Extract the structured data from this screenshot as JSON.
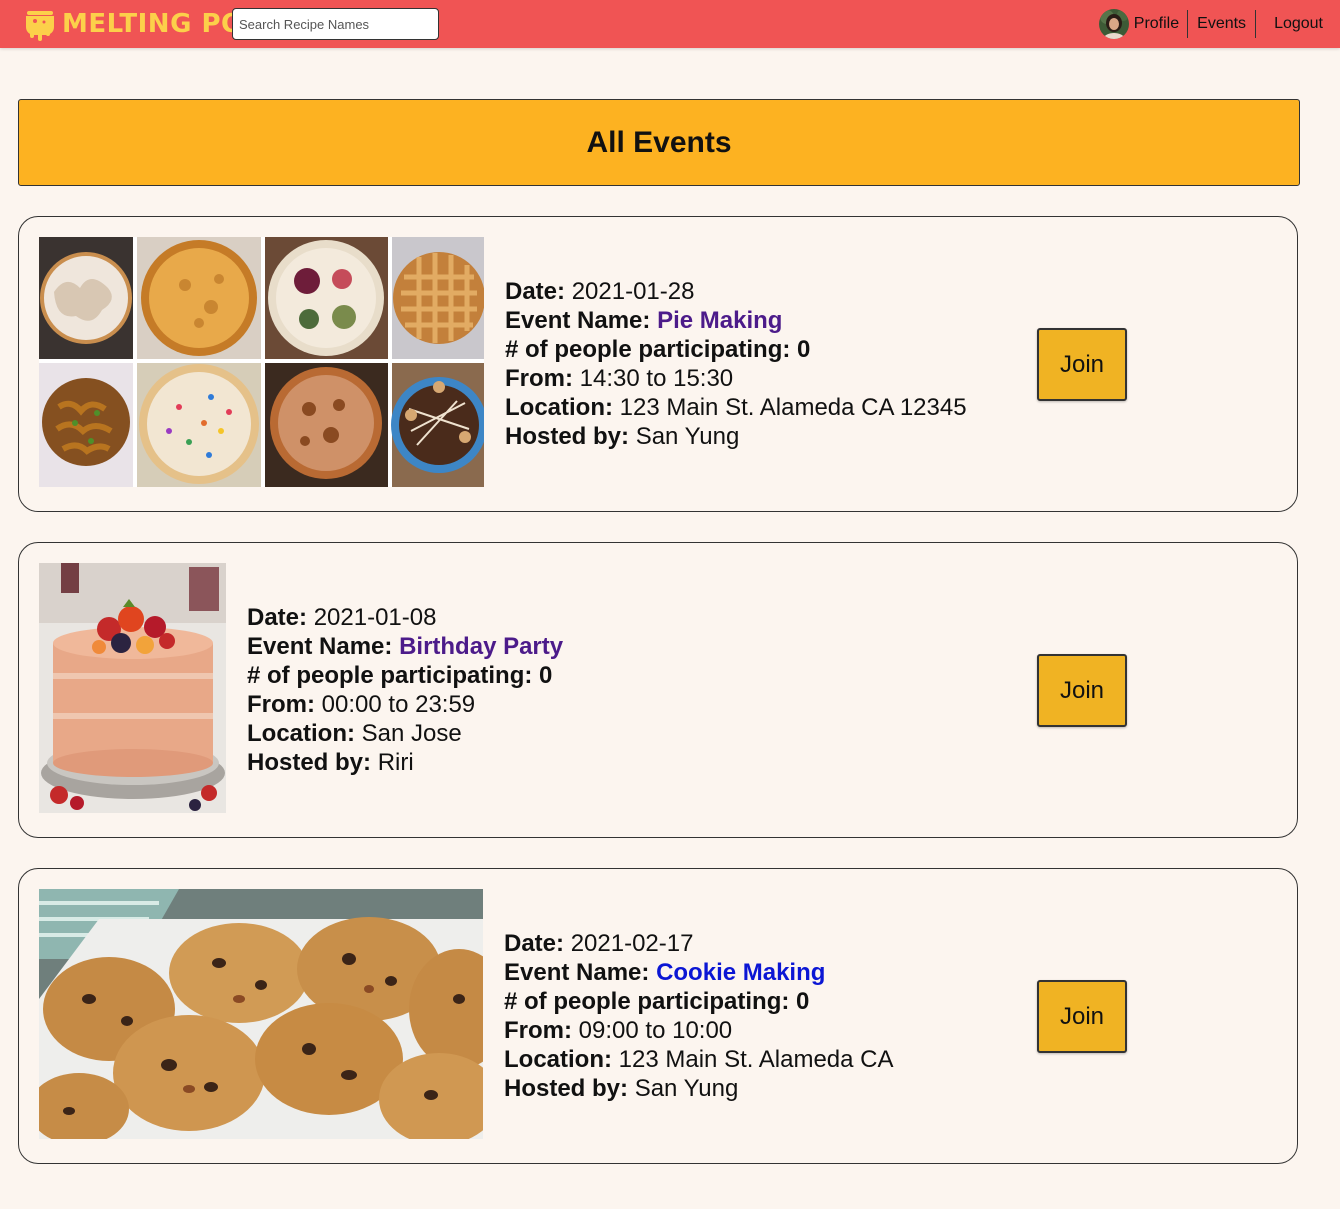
{
  "app": {
    "brand": "MELTING POT",
    "brand_color": "#fcd04a",
    "header_color": "#f05454",
    "background_color": "#fcf5ef"
  },
  "search": {
    "placeholder": "Search Recipe Names",
    "value": ""
  },
  "nav": {
    "profile": "Profile",
    "events": "Events",
    "logout": "Logout"
  },
  "page": {
    "title": "All Events",
    "banner_color": "#fdb221"
  },
  "labels": {
    "date": "Date:",
    "event_name": "Event Name:",
    "participants": "# of people participating:",
    "from": "From:",
    "to": "to",
    "location": "Location:",
    "hosted_by": "Hosted by:"
  },
  "events": [
    {
      "date": "2021-01-28",
      "name": "Pie Making",
      "participants": "0",
      "from": "14:30",
      "to": "15:30",
      "location": "123 Main St. Alameda CA 12345",
      "host": "San Yung",
      "join": "Join",
      "image": "pie-collage"
    },
    {
      "date": "2021-01-08",
      "name": "Birthday Party",
      "participants": "0",
      "from": "00:00",
      "to": "23:59",
      "location": "San Jose",
      "host": "Riri",
      "join": "Join",
      "image": "fruit-cake"
    },
    {
      "date": "2021-02-17",
      "name": "Cookie Making",
      "participants": "0",
      "from": "09:00",
      "to": "10:00",
      "location": "123 Main St. Alameda CA",
      "host": "San Yung",
      "join": "Join",
      "image": "chocolate-chip-cookies"
    }
  ]
}
